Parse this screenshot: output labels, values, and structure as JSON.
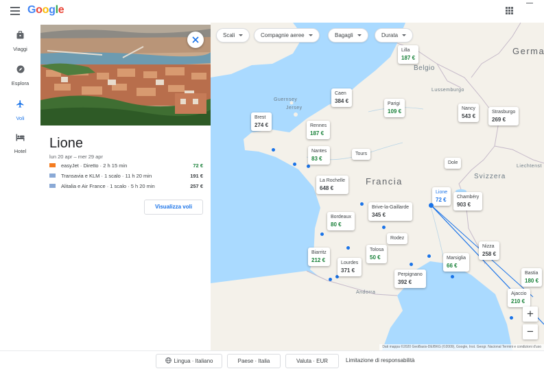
{
  "app": {
    "logo_letters": [
      {
        "ch": "G",
        "color": "#4285f4"
      },
      {
        "ch": "o",
        "color": "#ea4335"
      },
      {
        "ch": "o",
        "color": "#fbbc05"
      },
      {
        "ch": "g",
        "color": "#4285f4"
      },
      {
        "ch": "l",
        "color": "#34a853"
      },
      {
        "ch": "e",
        "color": "#ea4335"
      }
    ]
  },
  "nav": {
    "items": [
      {
        "label": "Viaggi",
        "icon": "briefcase-icon"
      },
      {
        "label": "Esplora",
        "icon": "compass-icon"
      },
      {
        "label": "Voli",
        "icon": "plane-icon",
        "active": true
      },
      {
        "label": "Hotel",
        "icon": "bed-icon"
      }
    ]
  },
  "destination": {
    "city": "Lione",
    "dates": "lun 20 apr – mer 29 apr",
    "flights": [
      {
        "airline": "easyJet · Diretto · 2 h 15 min",
        "price": "72 €",
        "cheapest": true,
        "color": "#f47c20"
      },
      {
        "airline": "Transavia e KLM · 1 scalo · 11 h 20 min",
        "price": "191 €",
        "cheapest": false,
        "color": "#8aa9d6"
      },
      {
        "airline": "Alitalia e Air France · 1 scalo · 5 h 20 min",
        "price": "257 €",
        "cheapest": false,
        "color": "#8aa9d6"
      }
    ],
    "view_button": "Visualizza voli"
  },
  "filters": [
    "Scali",
    "Compagnie aeree",
    "Bagagli",
    "Durata"
  ],
  "map": {
    "countries": {
      "france": "Francia",
      "belgium": "Belgio",
      "switzerland": "Svizzera",
      "germany": "Germa",
      "luxembourg": "Lussemburgo",
      "liechtenstein": "Liechtenst",
      "andorra": "Andorra",
      "guernsey": "Guernsey",
      "jersey": "Jersey"
    },
    "destinations": {
      "lille": {
        "name": "Lilla",
        "price": "187 €",
        "cheap": true
      },
      "caen": {
        "name": "Caen",
        "price": "384 €",
        "cheap": false
      },
      "paris": {
        "name": "Parigi",
        "price": "109 €",
        "cheap": true
      },
      "nancy": {
        "name": "Nancy",
        "price": "543 €",
        "cheap": false
      },
      "strasbourg": {
        "name": "Strasburgo",
        "price": "269 €",
        "cheap": false
      },
      "brest": {
        "name": "Brest",
        "price": "274 €",
        "cheap": false
      },
      "rennes": {
        "name": "Rennes",
        "price": "187 €",
        "cheap": true
      },
      "nantes": {
        "name": "Nantes",
        "price": "83 €",
        "cheap": true
      },
      "tours": {
        "name": "Tours"
      },
      "dole": {
        "name": "Dole"
      },
      "larochelle": {
        "name": "La Rochelle",
        "price": "648 €",
        "cheap": false
      },
      "lyon": {
        "name": "Lione",
        "price": "72 €",
        "origin": true
      },
      "chambery": {
        "name": "Chambéry",
        "price": "903 €",
        "cheap": false
      },
      "bordeaux": {
        "name": "Bordeaux",
        "price": "80 €",
        "cheap": true
      },
      "brive": {
        "name": "Brive-la-Gaillarde",
        "price": "345 €",
        "cheap": false
      },
      "rodez": {
        "name": "Rodez"
      },
      "nice": {
        "name": "Nizza",
        "price": "258 €",
        "cheap": false
      },
      "biarritz": {
        "name": "Biarritz",
        "price": "212 €",
        "cheap": true
      },
      "toulouse": {
        "name": "Tolosa",
        "price": "50 €",
        "cheap": true
      },
      "lourdes": {
        "name": "Lourdes",
        "price": "371 €",
        "cheap": false
      },
      "marseille": {
        "name": "Marsiglia",
        "price": "66 €",
        "cheap": true
      },
      "perpignan": {
        "name": "Perpignano",
        "price": "392 €",
        "cheap": false
      },
      "bastia": {
        "name": "Bastia",
        "price": "180 €",
        "cheap": true
      },
      "ajaccio": {
        "name": "Ajaccio",
        "price": "210 €",
        "cheap": true
      }
    },
    "attribution": "Dati mappa ©2020 GeoBasis-DE/BKG (©2009), Google, Inst. Geogr. Nacional   Termini e condizioni d'uso",
    "zoom_in": "+",
    "zoom_out": "−"
  },
  "footer": {
    "language": "Lingua · Italiano",
    "country": "Paese · Italia",
    "currency": "Valuta · EUR",
    "disclaimer": "Limitazione di responsabilità"
  }
}
